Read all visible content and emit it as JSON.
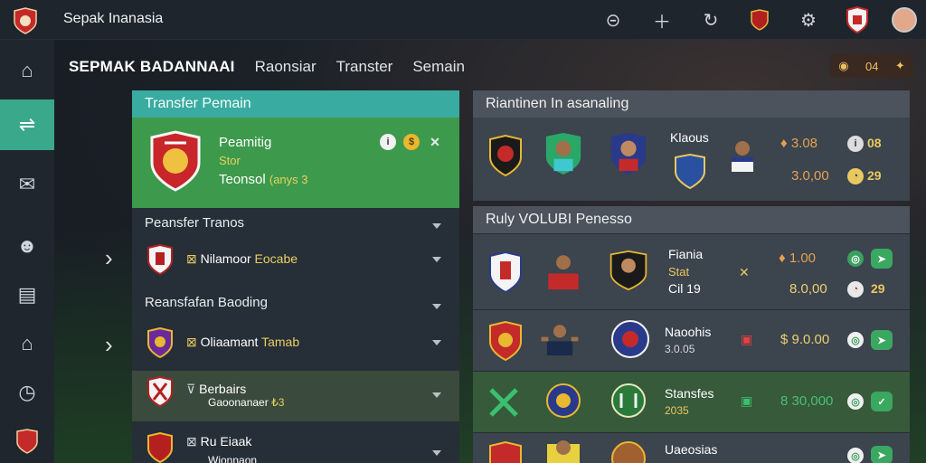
{
  "app": {
    "title": "Sepak Inanasia"
  },
  "nav": {
    "brand": "SEPMAK BADANNAAI",
    "tabs": [
      "Raonsiar",
      "Transter",
      "Semain"
    ]
  },
  "coins": {
    "icon": "coin-icon",
    "value": "04",
    "extra": "✦"
  },
  "top_icons": [
    "timer-icon",
    "plus-icon",
    "refresh-icon",
    "club-crest-icon",
    "bell-icon",
    "shield-icon",
    "avatar"
  ],
  "sidebar": [
    "home-icon",
    "transfer-icon",
    "mail-icon",
    "profile-icon",
    "inventory-icon",
    "home-icon",
    "clock-icon",
    "club-icon"
  ],
  "left_panel": {
    "title": "Transfer Pemain",
    "player": {
      "name": "Peamitig",
      "stat": "Stor",
      "detail": "Teonsol",
      "detail_value": "(anys 3"
    },
    "sections": [
      {
        "title": "Peansfer Tranos"
      },
      {
        "title": "Reansfafan Baoding"
      }
    ],
    "rows": [
      {
        "label": "Nilamoor",
        "value": "Eocabe"
      },
      {
        "label": "Oliaamant",
        "value": "Tamab"
      },
      {
        "label": "Berbairs",
        "value": "",
        "sub": "Gaoonanaer",
        "sub_value": "₺3"
      },
      {
        "label": "Ru Eiaak",
        "value": "",
        "sub": "Wionnaon",
        "sub_value": ""
      }
    ]
  },
  "rankings": {
    "title": "Riantinen In asanaling",
    "club": "Klaous",
    "price1": "3.08",
    "price2": "3.0,00",
    "badge1": "08",
    "badge2": "29"
  },
  "market": {
    "title": "Ruly VOLUBI Penesso",
    "rows": [
      {
        "name": "Fiania",
        "sub": "Stat",
        "sub2": "Cil 19",
        "price": "1.00",
        "price2": "8.0,00",
        "badge": "29"
      },
      {
        "name": "Naoohis",
        "sub": "3.0.05",
        "price": "$ 9.0.00"
      },
      {
        "name": "Stansfes",
        "sub": "2035",
        "price": "8 30,000"
      },
      {
        "name": "Uaeosias",
        "sub": "",
        "price": ""
      }
    ]
  },
  "colors": {
    "accent": "#3aa88a",
    "green": "#3d9a4c",
    "gold": "#e8d060"
  }
}
